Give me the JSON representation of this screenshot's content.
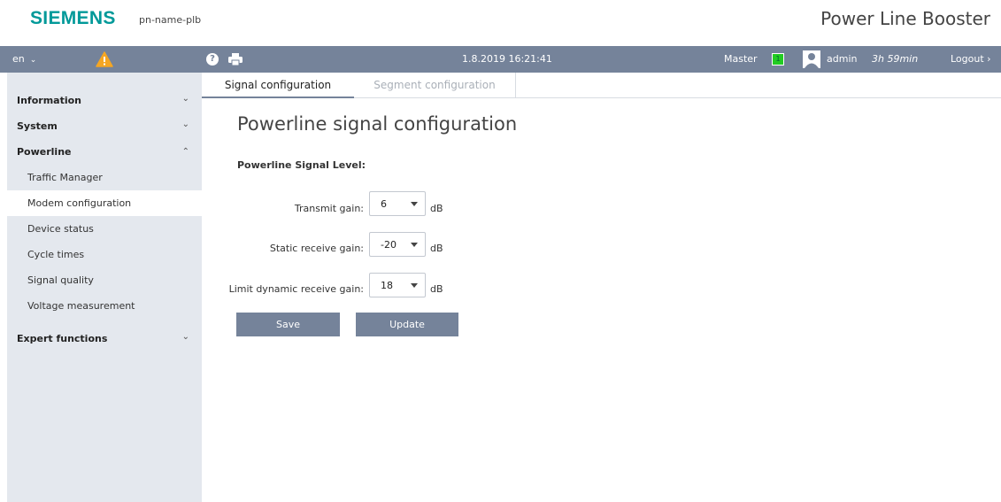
{
  "header": {
    "logo": "SIEMENS",
    "device_name": "pn-name-plb",
    "product": "Power Line Booster"
  },
  "toolbar": {
    "language": "en",
    "datetime": "1.8.2019 16:21:41",
    "role": "Master",
    "master_indicator": "1",
    "user": "admin",
    "session": "3h 59min",
    "logout": "Logout"
  },
  "sidebar": {
    "items": [
      {
        "label": "Information",
        "level": "top",
        "state": "collapsed"
      },
      {
        "label": "System",
        "level": "top",
        "state": "collapsed"
      },
      {
        "label": "Powerline",
        "level": "top",
        "state": "expanded"
      },
      {
        "label": "Traffic Manager",
        "level": "sub"
      },
      {
        "label": "Modem configuration",
        "level": "sub",
        "active": true
      },
      {
        "label": "Device status",
        "level": "sub"
      },
      {
        "label": "Cycle times",
        "level": "sub"
      },
      {
        "label": "Signal quality",
        "level": "sub"
      },
      {
        "label": "Voltage measurement",
        "level": "sub"
      },
      {
        "label": "Expert functions",
        "level": "top",
        "state": "collapsed"
      }
    ]
  },
  "tabs": [
    {
      "label": "Signal configuration",
      "active": true
    },
    {
      "label": "Segment configuration",
      "active": false
    }
  ],
  "main": {
    "title": "Powerline signal configuration",
    "section_title": "Powerline Signal Level:",
    "fields": [
      {
        "label": "Transmit gain:",
        "value": "6",
        "unit": "dB"
      },
      {
        "label": "Static receive gain:",
        "value": "-20",
        "unit": "dB"
      },
      {
        "label": "Limit dynamic receive gain:",
        "value": "18",
        "unit": "dB"
      }
    ],
    "save_label": "Save",
    "update_label": "Update"
  },
  "colors": {
    "brand": "#009999",
    "toolbar": "#75839a",
    "sidebar": "#e4e8ee",
    "status_ok": "#22cc22",
    "warning": "#f5a623"
  },
  "icons": [
    "warning-icon",
    "help-icon",
    "print-icon",
    "user-icon",
    "chevron-down-icon",
    "chevron-up-icon",
    "chevron-right-icon"
  ]
}
